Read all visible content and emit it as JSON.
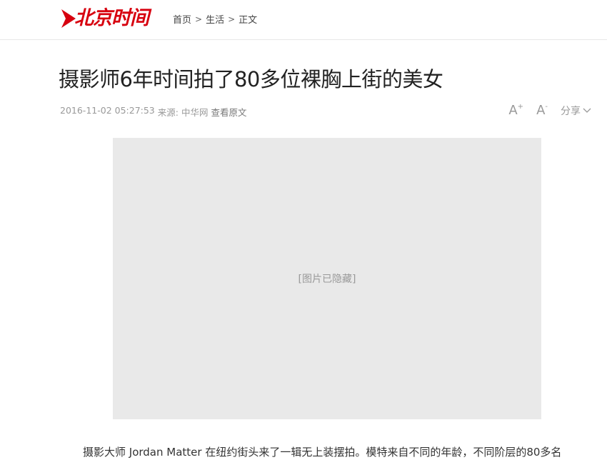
{
  "header": {
    "logo_text": "北京时间",
    "breadcrumb": [
      {
        "label": "首页"
      },
      {
        "label": "生活"
      },
      {
        "label": "正文"
      }
    ],
    "separator": ">"
  },
  "article": {
    "title": "摄影师6年时间拍了80多位裸胸上街的美女",
    "date": "2016-11-02 05:27:53",
    "source_label": "来源: 中华网",
    "view_original": "查看原文",
    "image_alt": "[图片已隐藏]",
    "first_paragraph": "摄影大师 Jordan Matter 在纽约街头来了一辑无上装摆拍。模特来自不同的年龄，不同阶层的80多名"
  },
  "tools": {
    "font_increase": "A",
    "font_increase_mark": "+",
    "font_decrease": "A",
    "font_decrease_mark": "-",
    "share_label": "分享"
  },
  "colors": {
    "brand": "#d7000f",
    "meta_gray": "#999999"
  }
}
